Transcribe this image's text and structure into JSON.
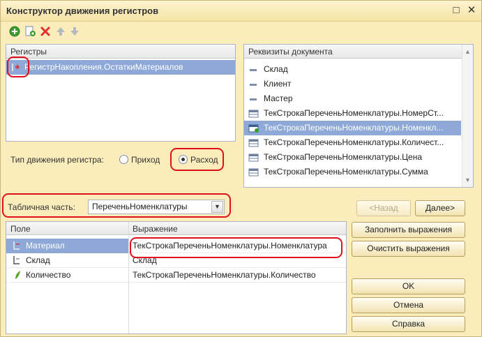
{
  "window": {
    "title": "Конструктор движения регистров",
    "restore_glyph": "□",
    "close_glyph": "✕"
  },
  "toolbar": {
    "icons": [
      "add-icon",
      "add-copy-icon",
      "delete-icon",
      "move-up-icon",
      "move-down-icon"
    ]
  },
  "registers": {
    "header": "Регистры",
    "items": [
      {
        "label": "РегистрНакопления.ОстаткиМатериалов",
        "selected": true
      }
    ]
  },
  "movement_type": {
    "label": "Тип движения регистра:",
    "options": [
      {
        "label": "Приход",
        "checked": false
      },
      {
        "label": "Расход",
        "checked": true
      }
    ]
  },
  "doc_attributes": {
    "header": "Реквизиты документа",
    "items": [
      {
        "label": "Склад",
        "icon": "attribute-icon"
      },
      {
        "label": "Клиент",
        "icon": "attribute-icon"
      },
      {
        "label": "Мастер",
        "icon": "attribute-icon"
      },
      {
        "label": "ТекСтрокаПереченьНоменклатуры.НомерСт...",
        "icon": "table-attribute-icon"
      },
      {
        "label": "ТекСтрокаПереченьНоменклатуры.Номенкл...",
        "icon": "table-attribute-icon",
        "selected": true
      },
      {
        "label": "ТекСтрокаПереченьНоменклатуры.Количест...",
        "icon": "table-attribute-icon"
      },
      {
        "label": "ТекСтрокаПереченьНоменклатуры.Цена",
        "icon": "table-attribute-icon"
      },
      {
        "label": "ТекСтрокаПереченьНоменклатуры.Сумма",
        "icon": "table-attribute-icon"
      }
    ]
  },
  "tabular_part": {
    "label": "Табличная часть:",
    "value": "ПереченьНоменклатуры"
  },
  "nav": {
    "back": "<Назад",
    "next": "Далее>"
  },
  "actions": {
    "fill": "Заполнить выражения",
    "clear": "Очистить выражения",
    "ok": "OK",
    "cancel": "Отмена",
    "help": "Справка"
  },
  "fields_table": {
    "columns": [
      "Поле",
      "Выражение"
    ],
    "rows": [
      {
        "field": "Материал",
        "expression": "ТекСтрокаПереченьНоменклатуры.Номенклатура",
        "icon": "dimension-icon",
        "selected": true
      },
      {
        "field": "Склад",
        "expression": "Склад",
        "icon": "dimension-icon"
      },
      {
        "field": "Количество",
        "expression": "ТекСтрокаПереченьНоменклатуры.Количество",
        "icon": "resource-icon"
      }
    ]
  }
}
